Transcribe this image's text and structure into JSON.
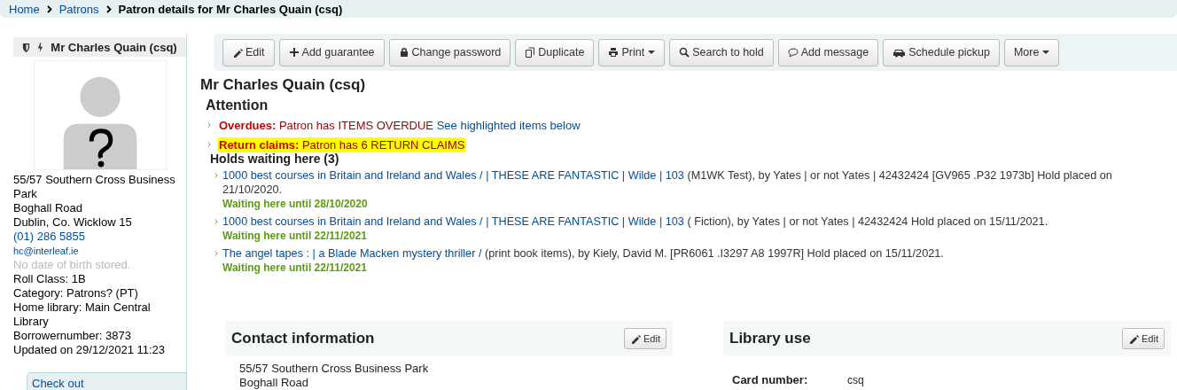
{
  "breadcrumb": {
    "links": [
      "Home",
      "Patrons"
    ],
    "current": "Patron details for Mr Charles Quain (csq)"
  },
  "sidebar": {
    "name": "Mr Charles Quain (csq)",
    "details": [
      {
        "kind": "text",
        "text": "55/57 Southern Cross Business Park"
      },
      {
        "kind": "text",
        "text": "Boghall Road"
      },
      {
        "kind": "text",
        "text": "Dublin, Co. Wicklow 15"
      },
      {
        "kind": "link",
        "text": "(01) 286 5855"
      },
      {
        "kind": "small-link",
        "text": "hc@interleaf.ie"
      },
      {
        "kind": "muted",
        "text": "No date of birth stored."
      },
      {
        "kind": "text",
        "text": "Roll Class: 1B"
      },
      {
        "kind": "text",
        "text": "Category: Patrons? (PT)"
      },
      {
        "kind": "text",
        "text": "Home library: Main Central Library"
      },
      {
        "kind": "text",
        "text": "Borrowernumber: 3873"
      },
      {
        "kind": "text",
        "text": "Updated on 29/12/2021 11:23"
      }
    ],
    "tabs": [
      {
        "label": "Check out",
        "selected": false
      }
    ]
  },
  "toolbar": [
    {
      "kind": "edit",
      "label": "Edit",
      "caret": false
    },
    {
      "kind": "add",
      "label": "Add guarantee",
      "caret": false
    },
    {
      "kind": "password",
      "label": "Change password",
      "caret": false
    },
    {
      "kind": "duplicate",
      "label": "Duplicate",
      "caret": false
    },
    {
      "kind": "print",
      "label": "Print",
      "caret": true
    },
    {
      "kind": "search",
      "label": "Search to hold",
      "caret": false
    },
    {
      "kind": "message",
      "label": "Add message",
      "caret": false
    },
    {
      "kind": "pickup",
      "label": "Schedule pickup",
      "caret": false
    },
    {
      "kind": "menu",
      "label": "More",
      "caret": true
    }
  ],
  "title": "Mr Charles Quain (csq)",
  "attention": {
    "heading": "Attention",
    "items": [
      {
        "label": "Overdues:",
        "text": "Patron has ITEMS OVERDUE",
        "link": "See highlighted items below",
        "highlighted": false
      },
      {
        "label": "Return claims:",
        "text": "Patron has 6 RETURN CLAIMS",
        "highlighted": true
      }
    ]
  },
  "holds": {
    "heading": "Holds waiting here (3)",
    "items": [
      {
        "title": "1000 best courses in Britain and Ireland and Wales / | THESE ARE FANTASTIC | Wilde | 103",
        "details": " (M1WK Test), by Yates | or not Yates | 42432424 [GV965 .P32 1973b] Hold placed on 21/10/2020.",
        "waiting": "Waiting here until 28/10/2020"
      },
      {
        "title": "1000 best courses in Britain and Ireland and Wales / | THESE ARE FANTASTIC | Wilde | 103",
        "details": " ( Fiction), by Yates | or not Yates | 42432424 Hold placed on 15/11/2021.",
        "waiting": "Waiting here until 22/11/2021"
      },
      {
        "title": "The angel tapes : | a Blade Macken mystery thriller /",
        "details": " (print book items), by Kiely, David M. [PR6061 .I3297 A8 1997R] Hold placed on 15/11/2021.",
        "waiting": "Waiting here until 22/11/2021"
      }
    ]
  },
  "panels": [
    {
      "title": "Contact information",
      "edit": "Edit",
      "kind": "address",
      "lines": [
        "55/57 Southern Cross Business Park",
        "Boghall Road"
      ]
    },
    {
      "title": "Library use",
      "edit": "Edit",
      "kind": "fields",
      "fields": [
        {
          "label": "Card number:",
          "value": "csq"
        }
      ]
    }
  ]
}
